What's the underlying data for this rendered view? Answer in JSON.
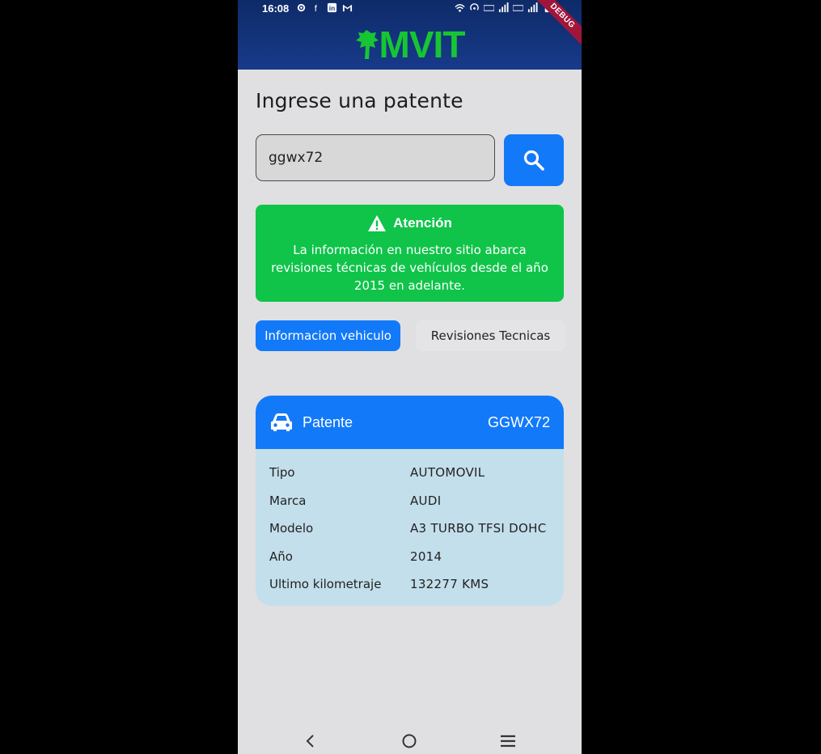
{
  "status_bar": {
    "time": "16:08",
    "debug_label": "DEBUG"
  },
  "header": {
    "logo_text": "MVIT"
  },
  "search": {
    "title": "Ingrese una patente",
    "input_value": "ggwx72"
  },
  "alert": {
    "title": "Atención",
    "body": "La información en nuestro sitio abarca revisiones técnicas de vehículos desde el año 2015 en adelante.",
    "color": "#0fc449"
  },
  "tabs": [
    {
      "label": "Informacion vehiculo",
      "active": true
    },
    {
      "label": "Revisiones Tecnicas",
      "active": false
    }
  ],
  "vehicle_card": {
    "header_label": "Patente",
    "plate": "GGWX72",
    "rows": [
      {
        "label": "Tipo",
        "value": "AUTOMOVIL"
      },
      {
        "label": "Marca",
        "value": "AUDI"
      },
      {
        "label": "Modelo",
        "value": "A3 TURBO TFSI DOHC"
      },
      {
        "label": "Año",
        "value": "2014"
      },
      {
        "label": "Ultimo kilometraje",
        "value": "132277 KMS"
      }
    ]
  },
  "colors": {
    "accent": "#1279f9",
    "header_bg": "#123277",
    "logo": "#17c534",
    "card_body": "#c3dfec"
  }
}
